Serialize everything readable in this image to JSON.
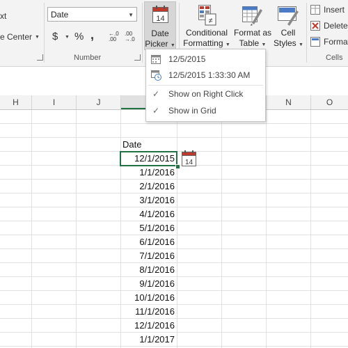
{
  "ribbon": {
    "alignment": {
      "wrap_partial": "xt",
      "merge_partial": "e Center"
    },
    "number": {
      "format_value": "Date",
      "currency": "$",
      "percent": "%",
      "comma": ",",
      "inc_decimal": "←.0 .00",
      "dec_decimal": ".00 →.0",
      "group_label": "Number"
    },
    "date_picker": {
      "icon_number": "14",
      "line1": "Date",
      "line2": "Picker"
    },
    "conditional_formatting": {
      "line1": "Conditional",
      "line2": "Formatting"
    },
    "format_as_table": {
      "line1": "Format as",
      "line2": "Table"
    },
    "cell_styles": {
      "line1": "Cell",
      "line2": "Styles"
    },
    "cells": {
      "insert": "Insert",
      "delete": "Delete",
      "format": "Format",
      "group_label": "Cells"
    }
  },
  "dropdown": {
    "items": [
      {
        "label": "12/5/2015",
        "icon": "calendar-icon"
      },
      {
        "label": "12/5/2015 1:33:30 AM",
        "icon": "calendar-clock-icon"
      },
      {
        "label": "Show on Right Click",
        "icon": "check-icon"
      },
      {
        "label": "Show in Grid",
        "icon": "check-icon"
      }
    ]
  },
  "columns": [
    "H",
    "I",
    "J",
    "",
    "",
    "",
    "N",
    "O"
  ],
  "sheet": {
    "header_cell": "Date",
    "picker_icon_number": "14",
    "dates": [
      "12/1/2015",
      "1/1/2016",
      "2/1/2016",
      "3/1/2016",
      "4/1/2016",
      "5/1/2016",
      "6/1/2016",
      "7/1/2016",
      "8/1/2016",
      "9/1/2016",
      "10/1/2016",
      "11/1/2016",
      "12/1/2016",
      "1/1/2017"
    ]
  },
  "colors": {
    "accent_green": "#217346",
    "calendar_red": "#c0392b"
  }
}
